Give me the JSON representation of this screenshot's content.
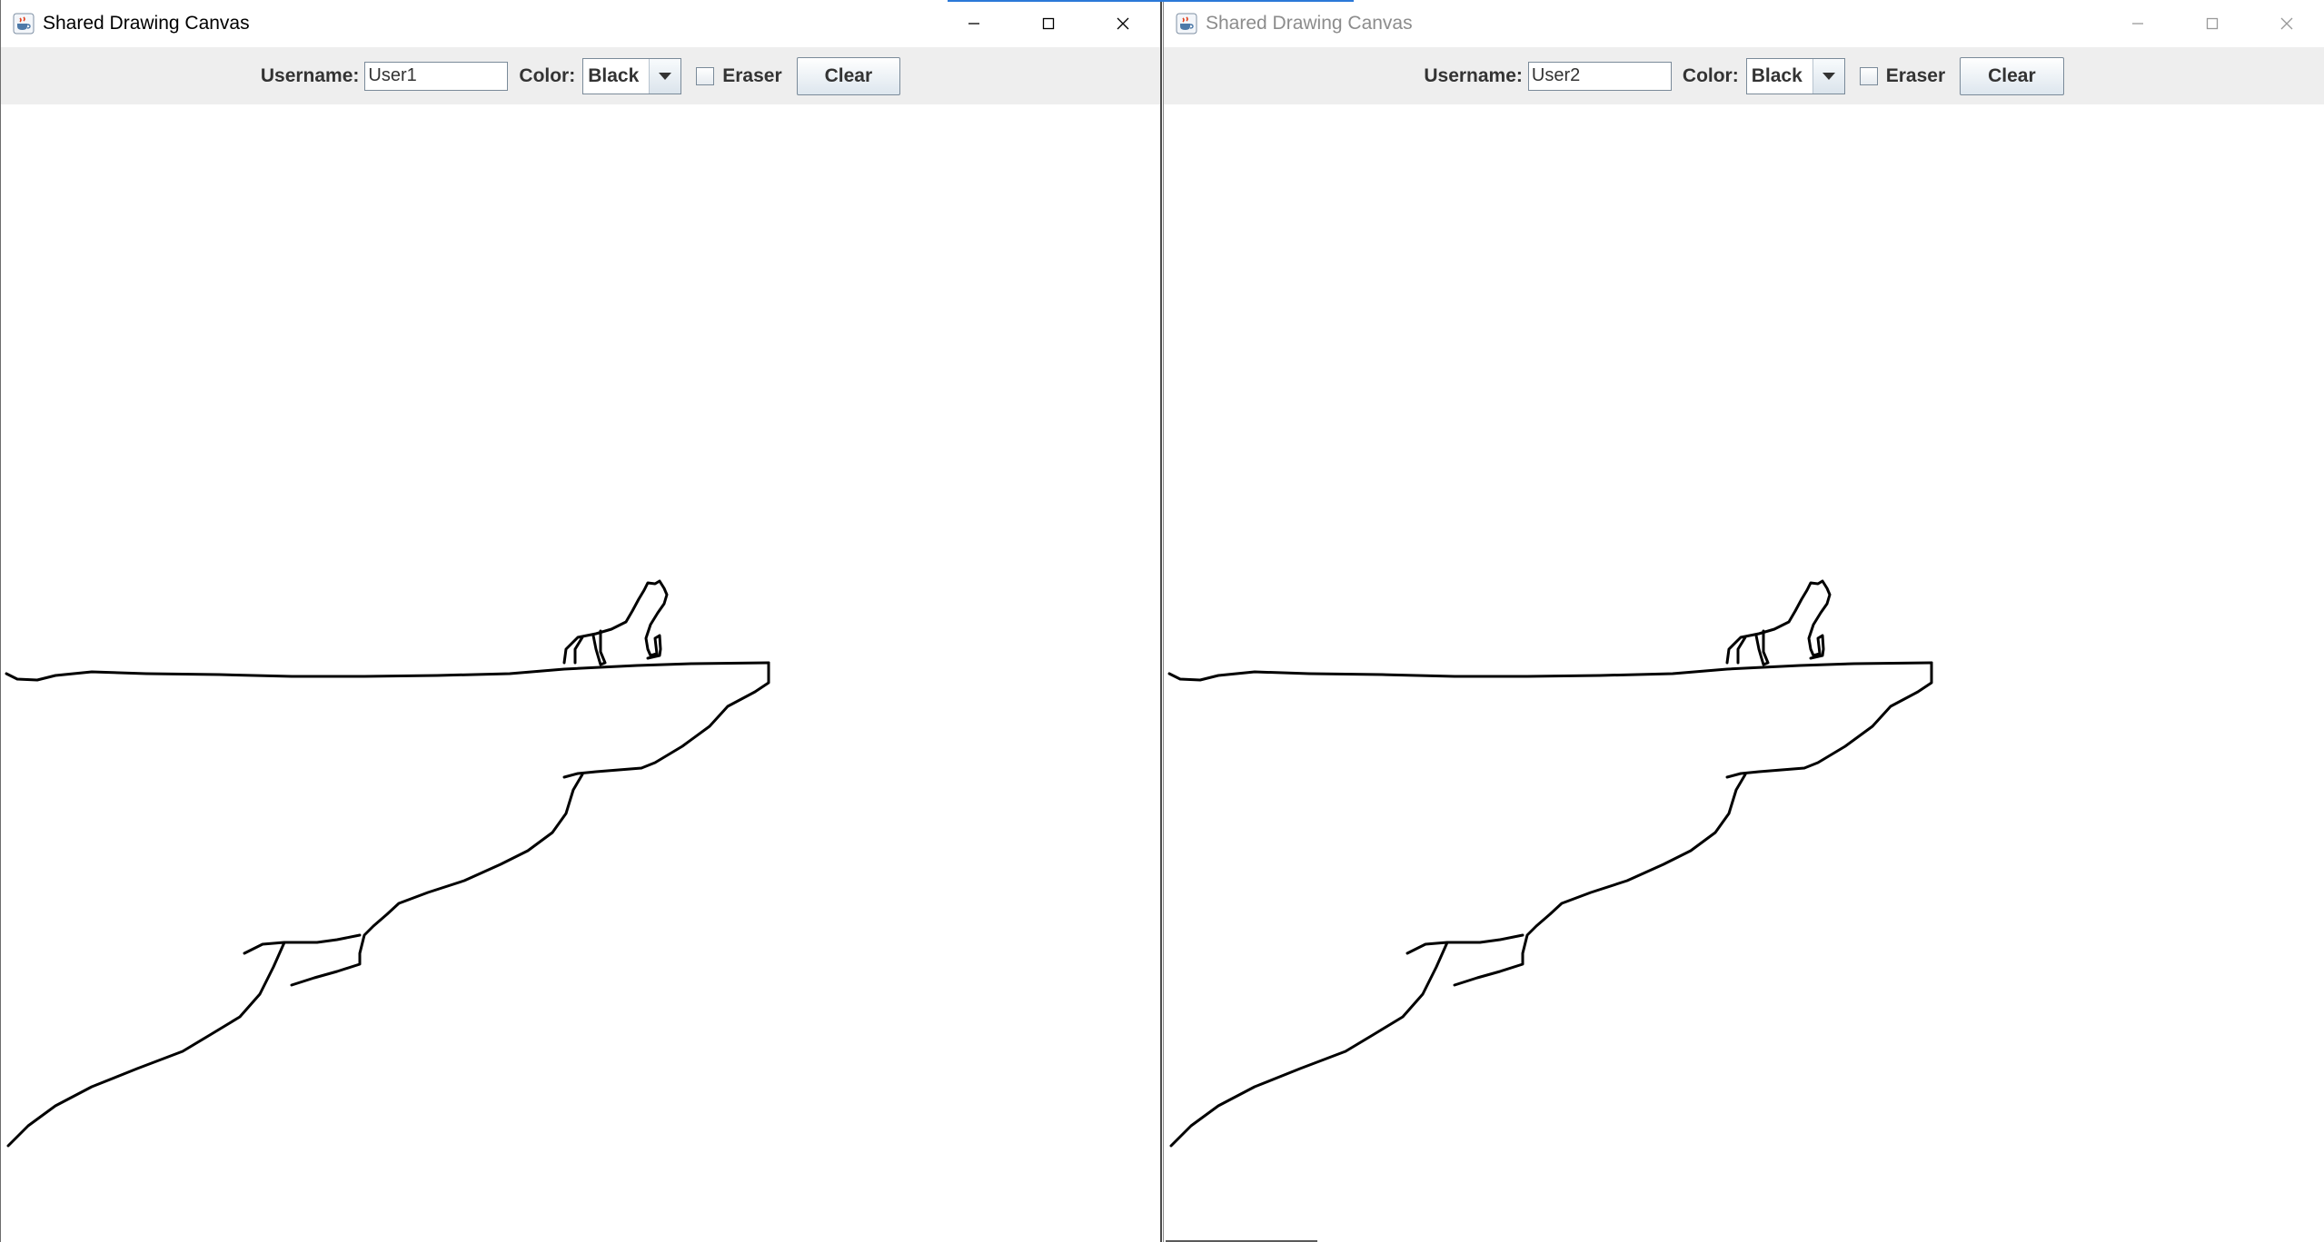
{
  "windows": [
    {
      "title": "Shared Drawing Canvas",
      "active": true,
      "toolbar": {
        "username_label": "Username:",
        "username_value": "User1",
        "color_label": "Color:",
        "color_value": "Black",
        "eraser_label": "Eraser",
        "eraser_checked": false,
        "clear_label": "Clear"
      }
    },
    {
      "title": "Shared Drawing Canvas",
      "active": false,
      "toolbar": {
        "username_label": "Username:",
        "username_value": "User2",
        "color_label": "Color:",
        "color_value": "Black",
        "eraser_label": "Eraser",
        "eraser_checked": false,
        "clear_label": "Clear"
      }
    }
  ],
  "icons": {
    "app": "java-coffee-cup-icon",
    "minimize": "minimize-icon",
    "maximize": "maximize-icon",
    "close": "close-icon",
    "dropdown": "dropdown-arrow-icon"
  },
  "colors": {
    "toolbar_bg": "#eeeeee",
    "stroke": "#000000",
    "accent": "#2b79d8"
  },
  "drawing": {
    "description_shown": "wolf howling on a cliff edge",
    "stroke_color": "#000000"
  }
}
